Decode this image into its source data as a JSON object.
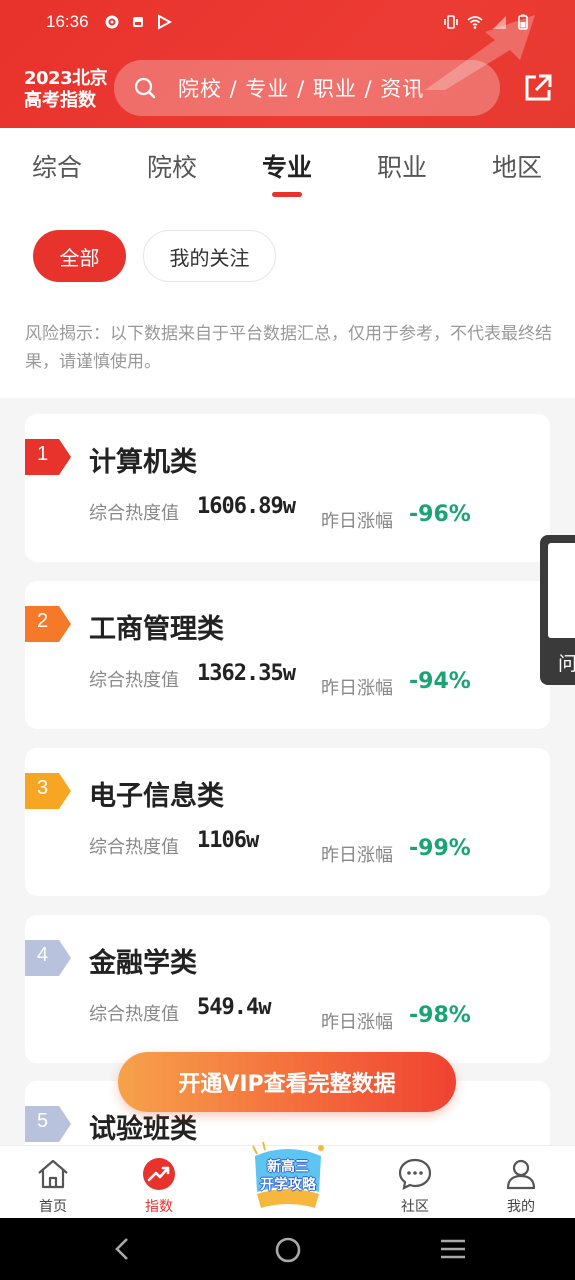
{
  "status_bar": {
    "time": "16:36"
  },
  "header": {
    "logo_line1": "2023北京",
    "logo_line2": "高考指数",
    "search_placeholder": "院校 / 专业 / 职业 / 资讯",
    "colors": {
      "brand": "#e8322c"
    }
  },
  "tabs": [
    {
      "label": "综合",
      "active": false
    },
    {
      "label": "院校",
      "active": false
    },
    {
      "label": "专业",
      "active": true
    },
    {
      "label": "职业",
      "active": false
    },
    {
      "label": "地区",
      "active": false
    }
  ],
  "filters": {
    "all": "全部",
    "follow": "我的关注"
  },
  "notice": "风险揭示：以下数据来自于平台数据汇总，仅用于参考，不代表最终结果，请谨慎使用。",
  "labels": {
    "hot": "综合热度值",
    "change": "昨日涨幅"
  },
  "list": [
    {
      "rank": "1",
      "name": "计算机类",
      "hot": "1606.89w",
      "change": "-96%"
    },
    {
      "rank": "2",
      "name": "工商管理类",
      "hot": "1362.35w",
      "change": "-94%"
    },
    {
      "rank": "3",
      "name": "电子信息类",
      "hot": "1106w",
      "change": "-99%"
    },
    {
      "rank": "4",
      "name": "金融学类",
      "hot": "549.4w",
      "change": "-98%"
    },
    {
      "rank": "5",
      "name": "试验班类"
    }
  ],
  "side_widget": {
    "label": "问"
  },
  "vip_button": "开通VIP查看完整数据",
  "bottom_nav": {
    "home": "首页",
    "index": "指数",
    "promo_line1": "新高三",
    "promo_line2": "开学攻略",
    "community": "社区",
    "mine": "我的"
  }
}
